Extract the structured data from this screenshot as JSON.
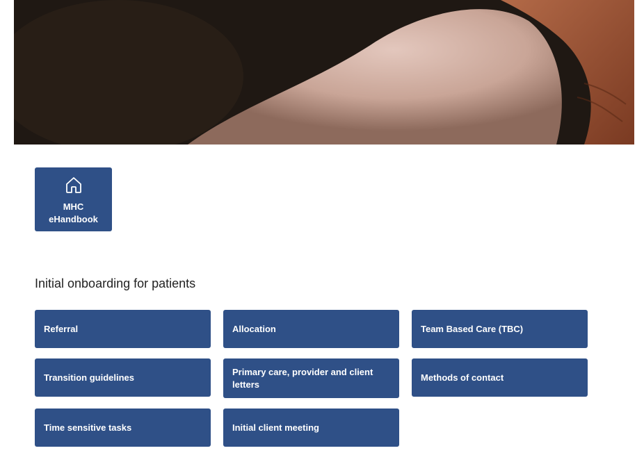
{
  "hero": {
    "image_name": "hands-holding-photo"
  },
  "home_tile": {
    "icon": "home-icon",
    "label": "MHC\neHandbook"
  },
  "section": {
    "title": "Initial onboarding for patients"
  },
  "tiles": [
    {
      "label": "Referral"
    },
    {
      "label": "Allocation"
    },
    {
      "label": "Team Based Care (TBC)"
    },
    {
      "label": "Transition guidelines"
    },
    {
      "label": "Primary care, provider and client letters"
    },
    {
      "label": "Methods of contact"
    },
    {
      "label": "Time sensitive tasks"
    },
    {
      "label": "Initial client meeting"
    }
  ],
  "colors": {
    "tile_bg": "#2f5087",
    "tile_text": "#ffffff",
    "heading_text": "#222222"
  }
}
